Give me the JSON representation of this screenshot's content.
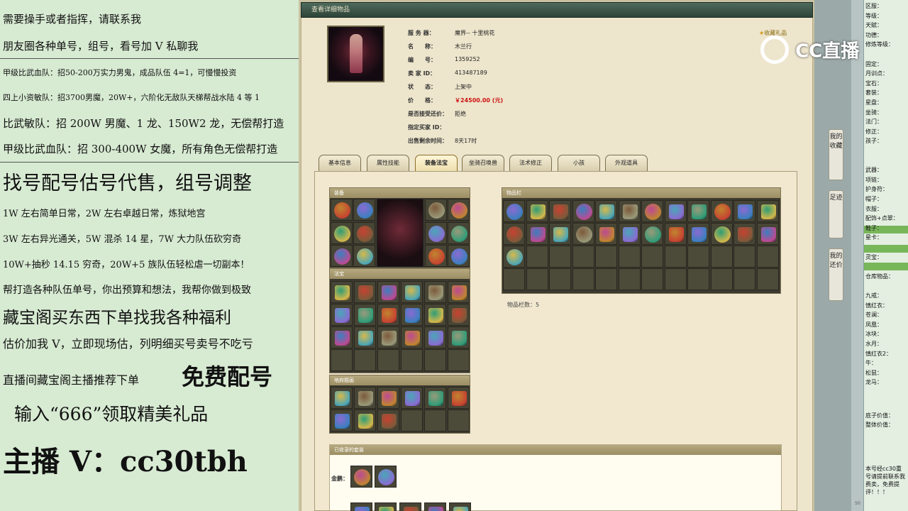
{
  "promo": {
    "lines": [
      "需要操手或者指挥，请联系我",
      "朋友圈各种单号，组号，看号加 V 私聊我",
      "甲级比武血队：招50-200万实力男鬼，成品队伍 4=1，可慢慢投资",
      "四上小资敏队：招3700男魔，20W+，六阶化无敌队天梯帮战水陆 4 等 1",
      "比武敏队：招 200W 男魔、1 龙、150W2 龙，无偿帮打造",
      "甲级比武血队：招 300-400W 女魔，所有角色无偿帮打造",
      "找号配号估号代售，组号调整",
      "1W 左右简单日常，2W 左右卓越日常，炼狱地宫",
      "3W 左右异光通关，5W 混杀 14 星，7W 大力队伍砍穷奇",
      "10W+抽秒 14.15 穷奇，20W+5 族队伍轻松虐一切副本！",
      "帮打造各种队伍单号，你出预算和想法，我帮你做到极致",
      "藏宝阁买东西下单找我各种福利",
      "估价加我 V，立即现场估，列明细买号卖号不吃亏",
      "直播间藏宝阁主播推荐下单",
      "免费配号",
      "输入“666”领取精美礼品",
      "主播 V：cc30tbh"
    ]
  },
  "window": {
    "title": "查看详细物品",
    "favorite": "收藏礼品",
    "info": [
      {
        "label": "服 务 器：",
        "value": "魔界-- 十里桃花"
      },
      {
        "label": "名　　称：",
        "value": "木兰行"
      },
      {
        "label": "编　　号：",
        "value": "1359252"
      },
      {
        "label": "卖 家 ID：",
        "value": "413487189"
      },
      {
        "label": "状　　态：",
        "value": "上架中"
      },
      {
        "label": "价　　格：",
        "value": "￥24500.00 (元)"
      },
      {
        "label": "是否接受还价：",
        "value": "拒绝"
      },
      {
        "label": "指定买家 ID：",
        "value": ""
      },
      {
        "label": "出售剩余时间：",
        "value": "8天17时"
      }
    ],
    "tabs": [
      "基本信息",
      "属性技能",
      "装备法宝",
      "坐骑召唤兽",
      "法术修正",
      "小孩",
      "外观道具"
    ],
    "active_tab": "装备法宝",
    "sections": {
      "equip": "装备",
      "fabao": "法宝",
      "zhuansheng": "地府题画",
      "bag": "物品栏",
      "bag_count": "物品栏数：5",
      "collected": "已收录的套装",
      "gold_label": "金鹏："
    }
  },
  "sheet": {
    "rows": [
      "区服：",
      "等级：",
      "天赋：",
      "功德：",
      "修炼等级：",
      "",
      "固定：",
      "月训点：",
      "宝石：",
      "套装：",
      "星盘：",
      "坐骑：",
      "法门：",
      "修正：",
      "孩子：",
      "",
      "",
      "武器：",
      "项链：",
      "护身符：",
      "帽子：",
      "衣服：",
      "配饰+点翠：",
      "鞋子：",
      "星卡：",
      "",
      "灵宝：",
      "",
      "仓库物品：",
      "",
      "九戒：",
      "慎红衣：",
      "苍澜：",
      "凤凰：",
      "冰块：",
      "水月：",
      "慎红衣2：",
      "牛：",
      "松鼠：",
      "龙马："
    ],
    "footer": [
      "底子价值：",
      "整体价值："
    ],
    "note": "本号经cc30重号请提前联系我费卖，免费提评！！！",
    "side_tabs": [
      "我的收藏",
      "足迹",
      "我的还价"
    ],
    "bottom_row": "50"
  },
  "watermark": "CC直播"
}
